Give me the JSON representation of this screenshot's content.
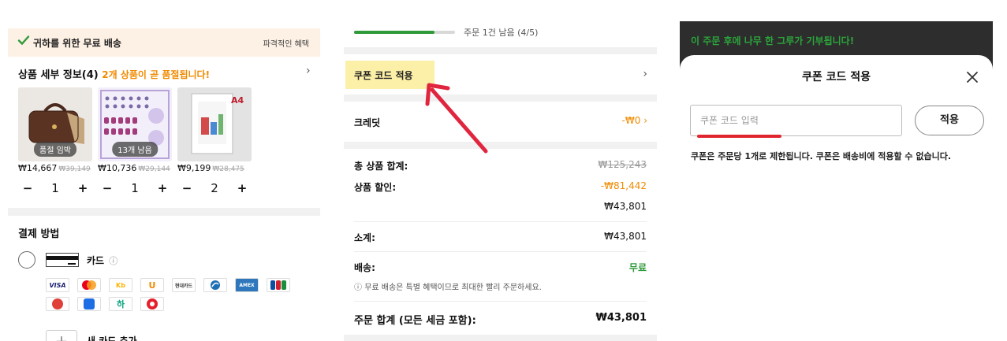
{
  "panel1": {
    "banner": {
      "text": "귀하를 위한 무료 배송",
      "right": "파격적인 혜택"
    },
    "details": {
      "title": "상품 세부 정보(4)",
      "warning": "2개 상품이 곧 품절됩니다!",
      "arrow": "›"
    },
    "products": [
      {
        "badge": "품절 임박",
        "price": "₩14,667",
        "old_price": "₩39,149",
        "qty": "1"
      },
      {
        "badge": "13개 남음",
        "price": "₩10,736",
        "old_price": "₩29,144",
        "qty": "1"
      },
      {
        "badge": "",
        "price": "₩9,199",
        "old_price": "₩28,475",
        "qty": "2",
        "tag": "A4"
      }
    ],
    "stepper": {
      "minus": "−",
      "plus": "+"
    },
    "payment": {
      "title": "결제 방법",
      "card_label": "카드",
      "card_help": "?",
      "logos_row1": [
        "VISA",
        "mc",
        "Kb",
        "U",
        "현대카드",
        "S",
        "AMEX",
        "JCB"
      ],
      "logos_row2": [
        "G",
        "samsung",
        "하",
        "L"
      ],
      "add_card": "새 카드 추가",
      "add_icon": "+"
    }
  },
  "panel2": {
    "progress": {
      "text": "주문 1건 남음 (4/5)",
      "value": 0.8
    },
    "coupon": {
      "label": "쿠폰 코드 적용",
      "arrow": "›"
    },
    "credit": {
      "label": "크레딧",
      "value": "-₩0 ›"
    },
    "summary": {
      "total_label": "총 상품 합계:",
      "total_value": "₩125,243",
      "discount_label": "상품 할인:",
      "discount_value": "-₩81,442",
      "after_discount": "₩43,801",
      "subtotal_label": "소계:",
      "subtotal_value": "₩43,801",
      "shipping_label": "배송:",
      "shipping_value": "무료",
      "notice": "무료 배송은 특별 혜택이므로 최대한 빨리 주문하세요.",
      "order_total_label": "주문 합계 (모든 세금 포함):",
      "order_total_value": "₩43,801"
    },
    "colors": {
      "accent_orange": "#f08a00",
      "green": "#2e9a3a",
      "highlight": "#fcefa7",
      "arrow_red": "#e0253f"
    }
  },
  "panel3": {
    "tree_text": "이 주문 후에 나무 한 그루가 기부됩니다!",
    "title": "쿠폰 코드 적용",
    "placeholder": "쿠폰 코드 입력",
    "apply_button": "적용",
    "note": "쿠폰은 주문당 1개로 제한됩니다. 쿠폰은 배송비에 적용할 수 없습니다.",
    "colors": {
      "dark": "#2d2d2d",
      "tree_green": "#2ba53b",
      "underline_red": "#e0252f"
    }
  }
}
